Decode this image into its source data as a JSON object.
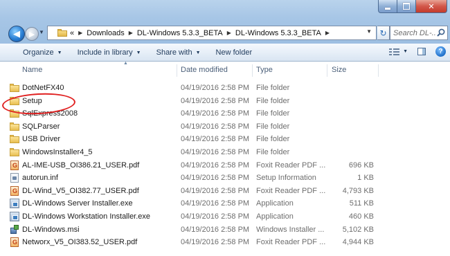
{
  "address": {
    "overflow": "«",
    "crumbs": [
      "Downloads",
      "DL-Windows 5.3.3_BETA",
      "DL-Windows 5.3.3_BETA"
    ]
  },
  "search": {
    "placeholder": "Search DL-..."
  },
  "toolbar": {
    "organize": "Organize",
    "include_in_library": "Include in library",
    "share_with": "Share with",
    "new_folder": "New folder"
  },
  "columns": {
    "name": "Name",
    "date": "Date modified",
    "type": "Type",
    "size": "Size"
  },
  "files": [
    {
      "name": "DotNetFX40",
      "date": "04/19/2016 2:58 PM",
      "type": "File folder",
      "size": "",
      "icon": "folder-icon"
    },
    {
      "name": "Setup",
      "date": "04/19/2016 2:58 PM",
      "type": "File folder",
      "size": "",
      "icon": "folder-icon"
    },
    {
      "name": "SqlExpress2008",
      "date": "04/19/2016 2:58 PM",
      "type": "File folder",
      "size": "",
      "icon": "folder-icon"
    },
    {
      "name": "SQLParser",
      "date": "04/19/2016 2:58 PM",
      "type": "File folder",
      "size": "",
      "icon": "folder-icon"
    },
    {
      "name": "USB Driver",
      "date": "04/19/2016 2:58 PM",
      "type": "File folder",
      "size": "",
      "icon": "folder-icon"
    },
    {
      "name": "WindowsInstaller4_5",
      "date": "04/19/2016 2:58 PM",
      "type": "File folder",
      "size": "",
      "icon": "folder-icon"
    },
    {
      "name": "AL-IME-USB_OI386.21_USER.pdf",
      "date": "04/19/2016 2:58 PM",
      "type": "Foxit Reader PDF ...",
      "size": "696 KB",
      "icon": "pdf-icon"
    },
    {
      "name": "autorun.inf",
      "date": "04/19/2016 2:58 PM",
      "type": "Setup Information",
      "size": "1 KB",
      "icon": "inf-icon"
    },
    {
      "name": "DL-Wind_V5_OI382.77_USER.pdf",
      "date": "04/19/2016 2:58 PM",
      "type": "Foxit Reader PDF ...",
      "size": "4,793 KB",
      "icon": "pdf-icon"
    },
    {
      "name": "DL-Windows Server Installer.exe",
      "date": "04/19/2016 2:58 PM",
      "type": "Application",
      "size": "511 KB",
      "icon": "exe-icon"
    },
    {
      "name": "DL-Windows Workstation Installer.exe",
      "date": "04/19/2016 2:58 PM",
      "type": "Application",
      "size": "460 KB",
      "icon": "exe-icon"
    },
    {
      "name": "DL-Windows.msi",
      "date": "04/19/2016 2:58 PM",
      "type": "Windows Installer ...",
      "size": "5,102 KB",
      "icon": "msi-icon"
    },
    {
      "name": "Networx_V5_OI383.52_USER.pdf",
      "date": "04/19/2016 2:58 PM",
      "type": "Foxit Reader PDF ...",
      "size": "4,944 KB",
      "icon": "pdf-icon"
    }
  ],
  "colors": {
    "frame": "#a7c6e6",
    "highlight": "#e02020",
    "toolbar_text": "#1e395b",
    "secondary_text": "#6d6d6d"
  }
}
